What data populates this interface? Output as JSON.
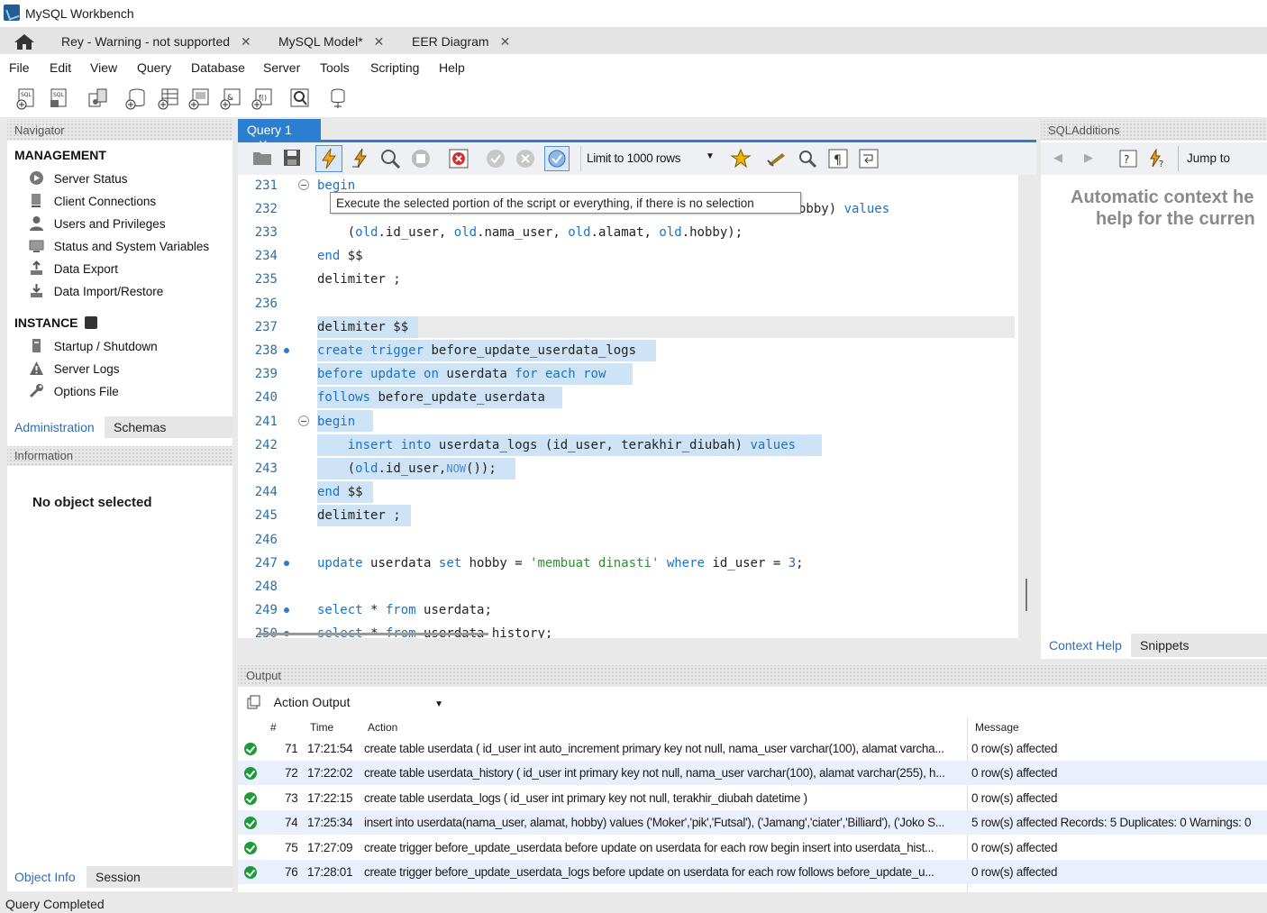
{
  "window": {
    "title": "MySQL Workbench"
  },
  "tabs": [
    {
      "label": "Rey - Warning - not supported"
    },
    {
      "label": "MySQL Model*"
    },
    {
      "label": "EER Diagram"
    }
  ],
  "menu": [
    "File",
    "Edit",
    "View",
    "Query",
    "Database",
    "Server",
    "Tools",
    "Scripting",
    "Help"
  ],
  "navigator": {
    "header": "Navigator",
    "management_title": "MANAGEMENT",
    "management": [
      "Server Status",
      "Client Connections",
      "Users and Privileges",
      "Status and System Variables",
      "Data Export",
      "Data Import/Restore"
    ],
    "instance_title": "INSTANCE",
    "instance": [
      "Startup / Shutdown",
      "Server Logs",
      "Options File"
    ],
    "tab_admin": "Administration",
    "tab_schemas": "Schemas"
  },
  "information": {
    "header": "Information",
    "empty": "No object selected",
    "tab_object": "Object Info",
    "tab_session": "Session"
  },
  "query": {
    "tab_label": "Query 1",
    "limit_label": "Limit to 1000 rows",
    "tooltip": "Execute the selected portion of the script or everything, if there is no selection"
  },
  "editor": {
    "lines": [
      {
        "n": "231",
        "text": "begin"
      },
      {
        "n": "232",
        "text": "obby) values"
      },
      {
        "n": "233",
        "text": "    (old.id_user, old.nama_user, old.alamat, old.hobby);"
      },
      {
        "n": "234",
        "text": "end $$"
      },
      {
        "n": "235",
        "text": "delimiter ;"
      },
      {
        "n": "236",
        "text": ""
      },
      {
        "n": "237",
        "text": "delimiter $$"
      },
      {
        "n": "238",
        "text": "create trigger before_update_userdata_logs"
      },
      {
        "n": "239",
        "text": "before update on userdata for each row"
      },
      {
        "n": "240",
        "text": "follows before_update_userdata"
      },
      {
        "n": "241",
        "text": "begin"
      },
      {
        "n": "242",
        "text": "    insert into userdata_logs (id_user, terakhir_diubah) values"
      },
      {
        "n": "243",
        "text": "    (old.id_user,NOW());"
      },
      {
        "n": "244",
        "text": "end $$"
      },
      {
        "n": "245",
        "text": "delimiter ;"
      },
      {
        "n": "246",
        "text": ""
      },
      {
        "n": "247",
        "text": "update userdata set hobby = 'membuat dinasti' where id_user = 3;"
      },
      {
        "n": "248",
        "text": ""
      },
      {
        "n": "249",
        "text": "select * from userdata;"
      },
      {
        "n": "250",
        "text": "select * from userdata_history;"
      }
    ]
  },
  "sql_additions": {
    "header": "SQLAdditions",
    "jump_to": "Jump to",
    "help_line1": "Automatic context he",
    "help_line2": "help for the curren",
    "tab_context": "Context Help",
    "tab_snippets": "Snippets"
  },
  "output": {
    "header": "Output",
    "selector": "Action Output",
    "columns": {
      "num": "#",
      "time": "Time",
      "action": "Action",
      "message": "Message"
    },
    "rows": [
      {
        "num": "71",
        "time": "17:21:54",
        "action": "create table userdata ( id_user int auto_increment primary key not null, nama_user varchar(100), alamat varcha...",
        "message": "0 row(s) affected"
      },
      {
        "num": "72",
        "time": "17:22:02",
        "action": "create table userdata_history (  id_user int primary key not null, nama_user varchar(100), alamat varchar(255), h...",
        "message": "0 row(s) affected"
      },
      {
        "num": "73",
        "time": "17:22:15",
        "action": "create table userdata_logs ( id_user int primary key not null, terakhir_diubah datetime )",
        "message": "0 row(s) affected"
      },
      {
        "num": "74",
        "time": "17:25:34",
        "action": "insert into userdata(nama_user, alamat, hobby) values  ('Moker','pik','Futsal'), ('Jamang','ciater','Billiard'), ('Joko S...",
        "message": "5 row(s) affected Records: 5  Duplicates: 0  Warnings: 0"
      },
      {
        "num": "75",
        "time": "17:27:09",
        "action": "create trigger before_update_userdata before update on userdata for each row  begin  insert into userdata_hist...",
        "message": "0 row(s) affected"
      },
      {
        "num": "76",
        "time": "17:28:01",
        "action": "create trigger before_update_userdata_logs before update on userdata for each row  follows before_update_u...",
        "message": "0 row(s) affected"
      }
    ]
  },
  "status": {
    "text": "Query Completed"
  }
}
